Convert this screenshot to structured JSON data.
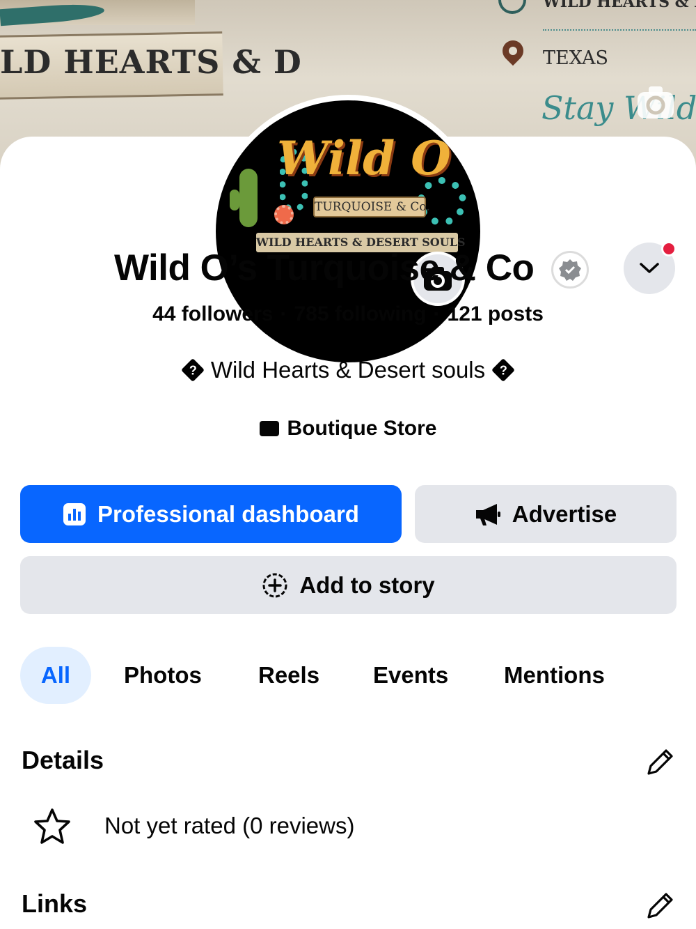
{
  "cover": {
    "left_text": "LD HEARTS & D",
    "sign_top_text": "WILD HEARTS & DE",
    "sign_location": "TEXAS",
    "sign_script": "Stay Wild,"
  },
  "avatar": {
    "logo_title": "Wild O",
    "logo_subtitle": "TURQUOISE & Co.",
    "logo_tagline": "WILD HEARTS & DESERT SOULS"
  },
  "profile": {
    "name": "Wild O’s Turquoise & Co",
    "followers": "44 followers",
    "following": "785 following",
    "posts": "121 posts",
    "separator": "·",
    "bio_icon_glyph": "?",
    "bio": "Wild Hearts & Desert souls",
    "category": "Boutique Store"
  },
  "actions": {
    "dashboard_label": "Professional dashboard",
    "advertise_label": "Advertise",
    "story_label": "Add to story"
  },
  "tabs": [
    "All",
    "Photos",
    "Reels",
    "Events",
    "Mentions"
  ],
  "details": {
    "title": "Details",
    "rating_text": "Not yet rated (0 reviews)"
  },
  "links": {
    "title": "Links"
  },
  "colors": {
    "primary": "#0866ff",
    "button_gray": "#e4e6eb",
    "tab_active_bg": "#e2efff",
    "notification": "#e41e3f"
  }
}
